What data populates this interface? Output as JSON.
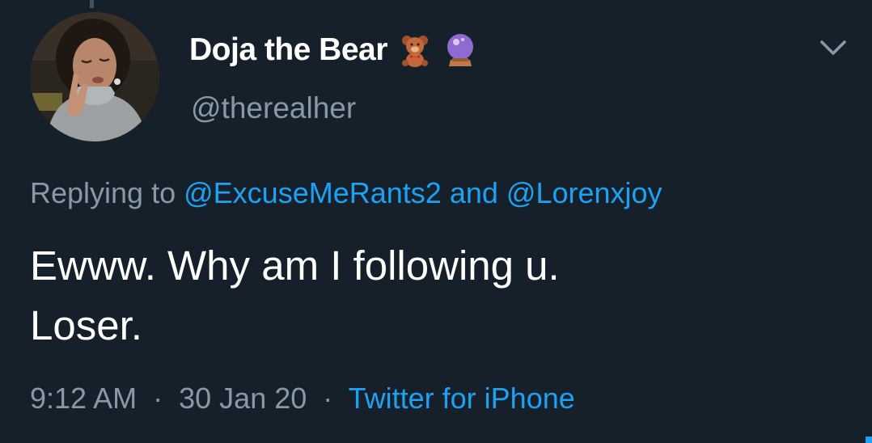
{
  "tweet": {
    "display_name": "Doja the Bear",
    "emojis": [
      "teddy-bear-icon",
      "crystal-ball-icon"
    ],
    "handle": "@therealher",
    "replying_prefix": "Replying to",
    "mention_1": "@ExcuseMeRants2",
    "mention_joiner": "and",
    "mention_2": "@Lorenxjoy",
    "body_line_1": "Ewww. Why am I following u.",
    "body_line_2": "Loser.",
    "time": "9:12 AM",
    "separator": "·",
    "date": "30 Jan 20",
    "source": "Twitter for iPhone"
  },
  "colors": {
    "background": "#15202b",
    "primary_text": "#ffffff",
    "secondary_text": "#8899a6",
    "accent": "#1da1f2"
  }
}
